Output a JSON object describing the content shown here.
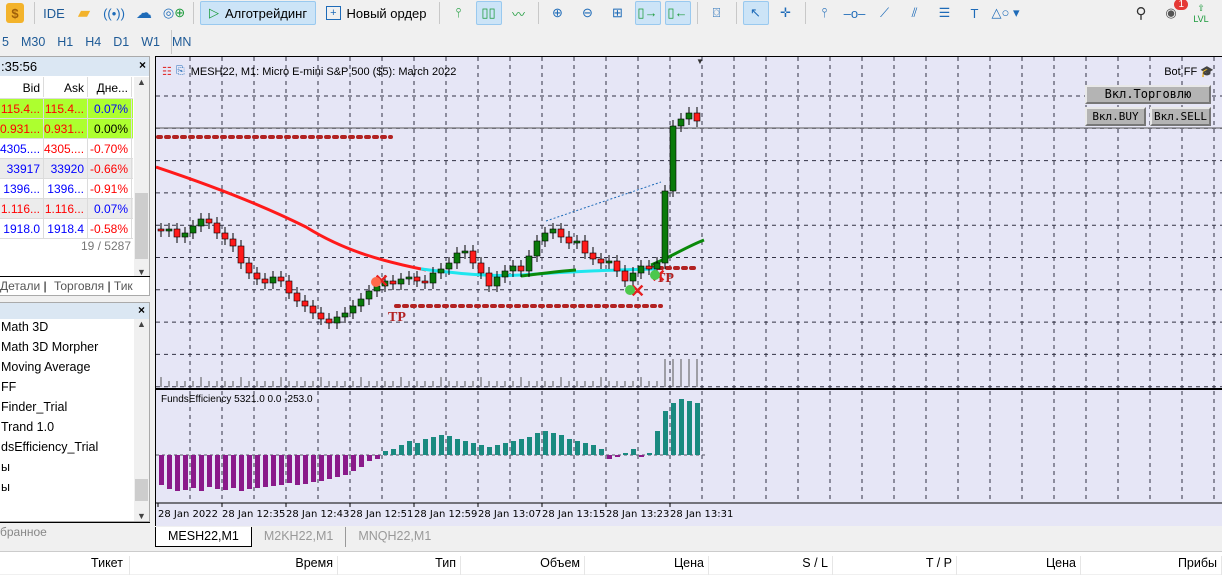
{
  "toolbar": {
    "ide": "IDE",
    "algo": "Алготрейдинг",
    "new_order": "Новый ордер",
    "notifications": "1",
    "lvl": "LVL"
  },
  "timeframes": [
    "5",
    "M30",
    "H1",
    "H4",
    "D1",
    "W1",
    "MN"
  ],
  "market_watch": {
    "time": ":35:56",
    "headers": [
      "Bid",
      "Ask",
      "Дне..."
    ],
    "rows": [
      {
        "bid": "115.4...",
        "ask": "115.4...",
        "change": "0.07%",
        "bid_color": "#ff0000",
        "ask_color": "#ff0000",
        "chg_color": "#0000ff",
        "bg": "#adff2f"
      },
      {
        "bid": "0.931...",
        "ask": "0.931...",
        "change": "0.00%",
        "bid_color": "#ff0000",
        "ask_color": "#ff0000",
        "chg_color": "#000000",
        "bg": "#adff2f"
      },
      {
        "bid": "4305....",
        "ask": "4305....",
        "change": "-0.70%",
        "bid_color": "#0000ff",
        "ask_color": "#ff0000",
        "chg_color": "#ff0000",
        "bg": "#ffffff"
      },
      {
        "bid": "33917",
        "ask": "33920",
        "change": "-0.66%",
        "bid_color": "#0000ff",
        "ask_color": "#0000ff",
        "chg_color": "#ff0000",
        "bg": "#ececec"
      },
      {
        "bid": "1396...",
        "ask": "1396...",
        "change": "-0.91%",
        "bid_color": "#0000ff",
        "ask_color": "#0000ff",
        "chg_color": "#ff0000",
        "bg": "#ffffff"
      },
      {
        "bid": "1.116...",
        "ask": "1.116...",
        "change": "0.07%",
        "bid_color": "#ff0000",
        "ask_color": "#ff0000",
        "chg_color": "#0000ff",
        "bg": "#ececec"
      },
      {
        "bid": "1918.0",
        "ask": "1918.4",
        "change": "-0.58%",
        "bid_color": "#0000ff",
        "ask_color": "#0000ff",
        "chg_color": "#ff0000",
        "bg": "#ffffff"
      }
    ],
    "count": "19 / 5287",
    "tabs": [
      "Детали",
      "Торговля",
      "Тик"
    ]
  },
  "navigator": {
    "items": [
      "Math 3D",
      "Math 3D Morpher",
      "Moving Average",
      "FF",
      "Finder_Trial",
      "Trand 1.0",
      "dsEfficiency_Trial",
      "ы",
      "ы"
    ],
    "tab": "бранное"
  },
  "chart": {
    "title": "MESH22, M1:  Micro E-mini S&P 500 ($5): March 2022",
    "bot_label": "Bot FF",
    "btn_trade": "Вкл.Торговлю",
    "btn_buy": "Вкл.BUY",
    "btn_sell": "Вкл.SELL",
    "tp_label": "TP",
    "indicator_label": "FundsEfficiency 5321.0 0.0 -253.0",
    "time_labels": [
      "28 Jan 2022",
      "28 Jan 12:35",
      "28 Jan 12:43",
      "28 Jan 12:51",
      "28 Jan 12:59",
      "28 Jan 13:07",
      "28 Jan 13:15",
      "28 Jan 13:23",
      "28 Jan 13:31"
    ],
    "tabs": [
      "MESH22,M1",
      "M2KH22,M1",
      "MNQH22,M1"
    ]
  },
  "chart_data": {
    "type": "candlestick",
    "symbol": "MESH22",
    "timeframe": "M1",
    "price_range": [
      4303,
      4385
    ],
    "closes": [
      4342.5,
      4343,
      4341,
      4342,
      4343.75,
      4345.5,
      4344.5,
      4342,
      4340.5,
      4338.75,
      4334.5,
      4332,
      4330.5,
      4329.5,
      4331,
      4330,
      4327,
      4325,
      4323.75,
      4322,
      4320.5,
      4319.5,
      4321,
      4322,
      4323.75,
      4325.5,
      4327.5,
      4328.75,
      4330,
      4329.25,
      4330.5,
      4331,
      4330,
      4329.5,
      4332,
      4333,
      4334.5,
      4337,
      4337.5,
      4334.5,
      4332,
      4328.75,
      4331,
      4332.5,
      4333.75,
      4332.5,
      4336.25,
      4340,
      4342,
      4343,
      4341,
      4339.5,
      4340,
      4337,
      4335.5,
      4334.5,
      4335,
      4332.5,
      4330,
      4332,
      4333.75,
      4333,
      4334.5,
      4352.5,
      4368.75,
      4370.5,
      4372,
      4370
    ],
    "indicator": [
      -30,
      -34,
      -36,
      -35,
      -33,
      -36,
      -32,
      -34,
      -35,
      -33,
      -36,
      -34,
      -33,
      -32,
      -31,
      -30,
      -28,
      -30,
      -29,
      -27,
      -26,
      -24,
      -22,
      -20,
      -16,
      -12,
      -6,
      -4,
      4,
      6,
      10,
      14,
      12,
      16,
      18,
      20,
      19,
      16,
      14,
      12,
      10,
      8,
      10,
      12,
      14,
      16,
      18,
      22,
      24,
      22,
      20,
      16,
      14,
      12,
      10,
      6,
      -4,
      -2,
      2,
      6,
      -2,
      2,
      24,
      44,
      52,
      56,
      54,
      52
    ]
  },
  "trade_table": {
    "headers": [
      "Тикет",
      "Время",
      "Тип",
      "Объем",
      "Цена",
      "S / L",
      "T / P",
      "Цена",
      "Прибы"
    ]
  }
}
